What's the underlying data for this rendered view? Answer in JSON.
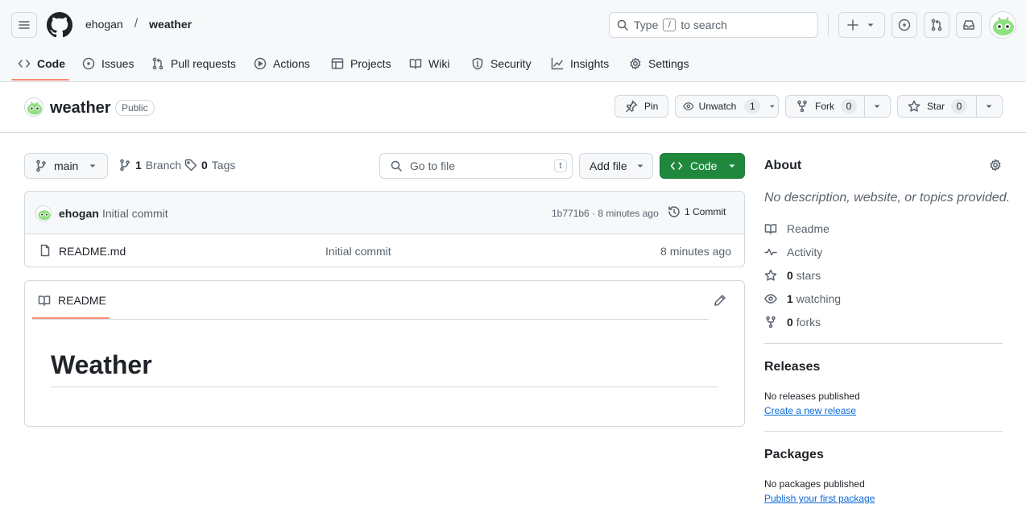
{
  "header": {
    "owner": "ehogan",
    "separator": "/",
    "repo": "weather",
    "search_type": "Type",
    "search_key": "/",
    "search_suffix": "to search"
  },
  "tabs": [
    {
      "label": "Code",
      "icon": "code-icon"
    },
    {
      "label": "Issues",
      "icon": "issue-icon"
    },
    {
      "label": "Pull requests",
      "icon": "pull-request-icon"
    },
    {
      "label": "Actions",
      "icon": "play-icon"
    },
    {
      "label": "Projects",
      "icon": "table-icon"
    },
    {
      "label": "Wiki",
      "icon": "book-icon"
    },
    {
      "label": "Security",
      "icon": "shield-icon"
    },
    {
      "label": "Insights",
      "icon": "graph-icon"
    },
    {
      "label": "Settings",
      "icon": "gear-icon"
    }
  ],
  "repo_title": {
    "name": "weather",
    "visibility": "Public",
    "pin": "Pin",
    "unwatch": "Unwatch",
    "watch_count": "1",
    "fork": "Fork",
    "fork_count": "0",
    "star": "Star",
    "star_count": "0"
  },
  "toolbar": {
    "branch": "main",
    "branch_count": "1",
    "branch_label": "Branch",
    "tag_count": "0",
    "tag_label": "Tags",
    "go_to_file": "Go to file",
    "go_to_file_key": "t",
    "add_file": "Add file",
    "code": "Code"
  },
  "commit": {
    "author": "ehogan",
    "message": "Initial commit",
    "hash_time": "1b771b6 · 8 minutes ago",
    "commits": "1 Commit"
  },
  "files": [
    {
      "name": "README.md",
      "message": "Initial commit",
      "time": "8 minutes ago"
    }
  ],
  "readme": {
    "tab": "README",
    "heading": "Weather"
  },
  "about": {
    "title": "About",
    "description": "No description, website, or topics provided.",
    "readme": "Readme",
    "activity": "Activity",
    "stars_count": "0",
    "stars": "stars",
    "watching_count": "1",
    "watching": "watching",
    "forks_count": "0",
    "forks": "forks"
  },
  "releases": {
    "title": "Releases",
    "text": "No releases published",
    "link": "Create a new release"
  },
  "packages": {
    "title": "Packages",
    "text": "No packages published",
    "link": "Publish your first package"
  },
  "colors": {
    "accent": "#fd8c73",
    "primary_button": "#1f883d",
    "link": "#0969da"
  }
}
